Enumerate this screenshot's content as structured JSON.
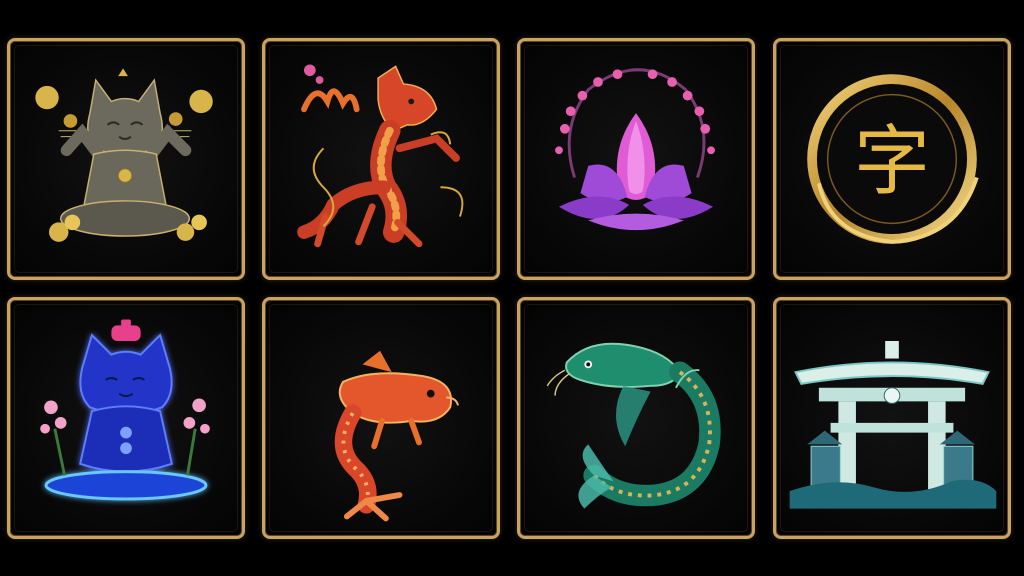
{
  "board": {
    "tiles": [
      {
        "id": "tile-1",
        "icon": "maneki-cat-icon",
        "accent": "#d8b54a"
      },
      {
        "id": "tile-2",
        "icon": "dragon-icon",
        "accent": "#e2542a"
      },
      {
        "id": "tile-3",
        "icon": "lotus-icon",
        "accent": "#c85ad8"
      },
      {
        "id": "tile-4",
        "icon": "golden-ring-character-icon",
        "accent": "#d9a934",
        "glyph": "字"
      },
      {
        "id": "tile-5",
        "icon": "neon-blue-cat-icon",
        "accent": "#3a5cff"
      },
      {
        "id": "tile-6",
        "icon": "red-koi-fish-icon",
        "accent": "#e0502a"
      },
      {
        "id": "tile-7",
        "icon": "green-koi-fish-icon",
        "accent": "#2aa57a"
      },
      {
        "id": "tile-8",
        "icon": "torii-gate-icon",
        "accent": "#7ac6c4"
      }
    ]
  }
}
